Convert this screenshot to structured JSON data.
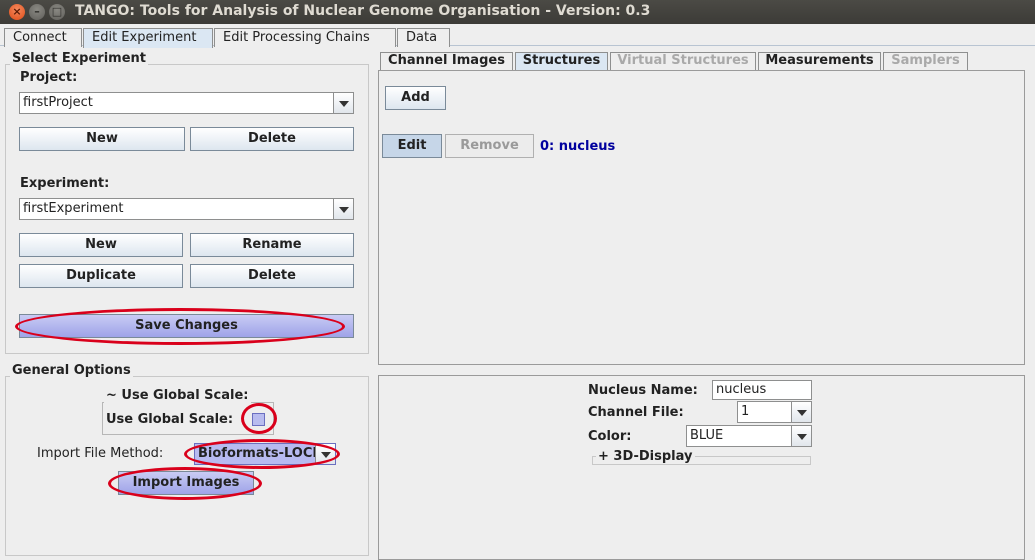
{
  "window": {
    "title": "TANGO: Tools for Analysis of Nuclear Genome Organisation - Version: 0.3"
  },
  "main_tabs": [
    {
      "label": "Connect"
    },
    {
      "label": "Edit Experiment"
    },
    {
      "label": "Edit Processing Chains"
    },
    {
      "label": "Data"
    }
  ],
  "select_experiment": {
    "legend": "Select Experiment",
    "project_label": "Project:",
    "project_value": "firstProject",
    "new_label": "New",
    "delete_label": "Delete",
    "experiment_label": "Experiment:",
    "experiment_value": "firstExperiment",
    "exp_new_label": "New",
    "exp_rename_label": "Rename",
    "exp_duplicate_label": "Duplicate",
    "exp_delete_label": "Delete",
    "save_label": "Save Changes"
  },
  "general_options": {
    "legend": "General Options",
    "global_scale_legend": "~ Use Global Scale:",
    "global_scale_label": "Use Global Scale:",
    "import_method_label": "Import File Method:",
    "import_method_value": "Bioformats-LOCI",
    "import_images_label": "Import Images"
  },
  "sub_tabs": [
    {
      "label": "Channel Images"
    },
    {
      "label": "Structures"
    },
    {
      "label": "Virtual Structures"
    },
    {
      "label": "Measurements"
    },
    {
      "label": "Samplers"
    }
  ],
  "structures": {
    "add_label": "Add",
    "edit_label": "Edit",
    "remove_label": "Remove",
    "item_label": "0: nucleus"
  },
  "properties": {
    "nucleus_name_label": "Nucleus Name:",
    "nucleus_name_value": "nucleus",
    "channel_file_label": "Channel File:",
    "channel_file_value": "1",
    "color_label": "Color:",
    "color_value": "BLUE",
    "display_label": "+ 3D-Display"
  },
  "colors": {
    "highlight": "#d9001b",
    "link": "#00009e",
    "accent": "#9ea3e8"
  }
}
